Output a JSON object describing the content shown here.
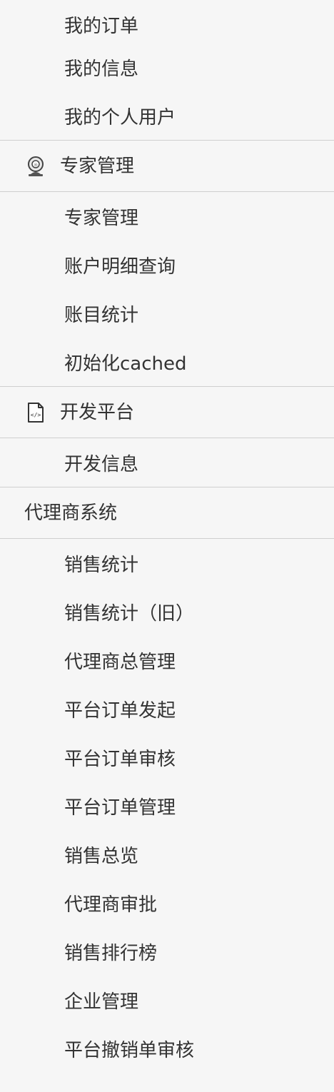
{
  "nav": {
    "account_items": [
      {
        "label": "我的订单"
      },
      {
        "label": "我的信息"
      },
      {
        "label": "我的个人用户"
      }
    ],
    "expert_section": {
      "title": "专家管理",
      "icon": "expert-icon",
      "items": [
        {
          "label": "专家管理"
        },
        {
          "label": "账户明细查询"
        },
        {
          "label": "账目统计"
        },
        {
          "label": "初始化cached"
        }
      ]
    },
    "dev_section": {
      "title": "开发平台",
      "icon": "code-file-icon",
      "items": [
        {
          "label": "开发信息"
        }
      ]
    },
    "agent_section": {
      "title": "代理商系统",
      "items": [
        {
          "label": "销售统计"
        },
        {
          "label": "销售统计（旧）"
        },
        {
          "label": "代理商总管理"
        },
        {
          "label": "平台订单发起"
        },
        {
          "label": "平台订单审核"
        },
        {
          "label": "平台订单管理"
        },
        {
          "label": "销售总览"
        },
        {
          "label": "代理商审批"
        },
        {
          "label": "销售排行榜"
        },
        {
          "label": "企业管理"
        },
        {
          "label": "平台撤销单审核"
        }
      ]
    }
  }
}
